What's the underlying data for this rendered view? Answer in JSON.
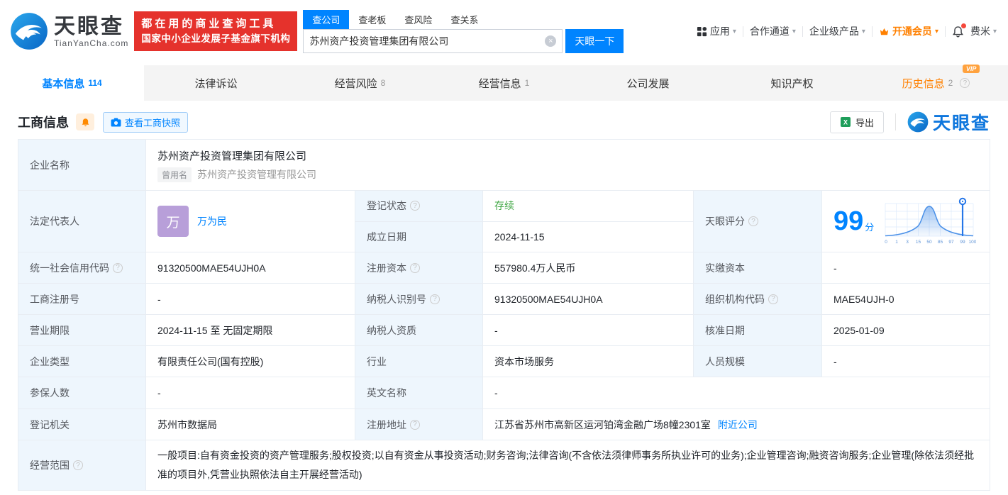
{
  "header": {
    "logo_title": "天眼查",
    "logo_subtitle": "TianYanCha.com",
    "promo_line1": "都在用的商业查询工具",
    "promo_line2": "国家中小企业发展子基金旗下机构",
    "search_tabs": [
      {
        "label": "查公司"
      },
      {
        "label": "查老板"
      },
      {
        "label": "查风险"
      },
      {
        "label": "查关系"
      }
    ],
    "search_value": "苏州资产投资管理集团有限公司",
    "search_button": "天眼一下",
    "nav_apps": "应用",
    "nav_partner": "合作通道",
    "nav_enterprise": "企业级产品",
    "nav_vip": "开通会员",
    "nav_user": "费米"
  },
  "main_tabs": [
    {
      "label": "基本信息",
      "count": "114"
    },
    {
      "label": "法律诉讼",
      "count": ""
    },
    {
      "label": "经营风险",
      "count": "8"
    },
    {
      "label": "经营信息",
      "count": "1"
    },
    {
      "label": "公司发展",
      "count": ""
    },
    {
      "label": "知识产权",
      "count": ""
    },
    {
      "label": "历史信息",
      "count": "2",
      "badge": "VIP"
    }
  ],
  "section": {
    "title": "工商信息",
    "snapshot_button": "查看工商快照",
    "export_button": "导出",
    "brand": "天眼查"
  },
  "table": {
    "name_row": {
      "label": "企业名称",
      "value": "苏州资产投资管理集团有限公司",
      "former_tag": "曾用名",
      "former_value": "苏州资产投资管理有限公司"
    },
    "rep_row": {
      "label": "法定代表人",
      "avatar": "万",
      "name": "万为民",
      "status_label": "登记状态",
      "status_value": "存续",
      "date_label": "成立日期",
      "date_value": "2024-11-15"
    },
    "score": {
      "label": "天眼评分",
      "value": "99",
      "unit": "分",
      "marker": "99",
      "axis": [
        "0",
        "1",
        "3",
        "15",
        "50",
        "85",
        "97",
        "99",
        "100"
      ]
    },
    "grid": [
      {
        "l1": "统一社会信用代码",
        "v1": "91320500MAE54UJH0A",
        "l2": "注册资本",
        "v2": "557980.4万人民币",
        "l3": "实缴资本",
        "v3": "-"
      },
      {
        "l1": "工商注册号",
        "v1": "-",
        "l2": "纳税人识别号",
        "v2": "91320500MAE54UJH0A",
        "l3": "组织机构代码",
        "v3": "MAE54UJH-0"
      },
      {
        "l1": "营业期限",
        "v1": "2024-11-15 至 无固定期限",
        "l2": "纳税人资质",
        "v2": "-",
        "l3": "核准日期",
        "v3": "2025-01-09"
      },
      {
        "l1": "企业类型",
        "v1": "有限责任公司(国有控股)",
        "l2": "行业",
        "v2": "资本市场服务",
        "l3": "人员规模",
        "v3": "-"
      }
    ],
    "insured_row": {
      "label": "参保人数",
      "value": "-",
      "label2": "英文名称",
      "value2": "-"
    },
    "registry_row": {
      "label": "登记机关",
      "value": "苏州市数据局",
      "label2": "注册地址",
      "value2": "江苏省苏州市高新区运河铂湾金融广场8幢2301室",
      "link": "附近公司"
    },
    "scope_row": {
      "label": "经营范围",
      "value": "一般项目:自有资金投资的资产管理服务;股权投资;以自有资金从事投资活动;财务咨询;法律咨询(不含依法须律师事务所执业许可的业务);企业管理咨询;融资咨询服务;企业管理(除依法须经批准的项目外,凭营业执照依法自主开展经营活动)"
    }
  },
  "colors": {
    "accent_blue": "#0084ff",
    "promo_red": "#e5322c",
    "vip_orange": "#ff8000",
    "status_green": "#42a846",
    "avatar_purple": "#b89fd9",
    "excel_green": "#1e9e5a",
    "label_cell_bg": "#eef6fd"
  }
}
